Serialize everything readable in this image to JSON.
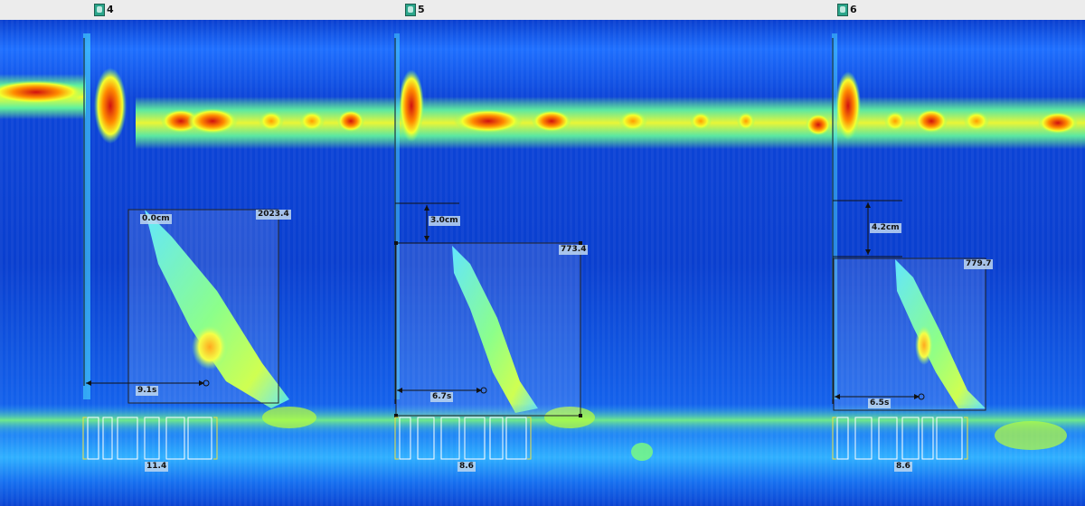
{
  "markers": [
    {
      "label": "4",
      "icon": "swallow-marker-icon"
    },
    {
      "label": "5",
      "icon": "swallow-marker-icon"
    },
    {
      "label": "6",
      "icon": "swallow-marker-icon"
    }
  ],
  "colors": {
    "background": "#0a3fcf",
    "colormap": [
      "#0000b4",
      "#0a3fcf",
      "#2aa8ff",
      "#4de3ff",
      "#7dff7a",
      "#f4ff2e",
      "#ff9d00",
      "#e61616"
    ]
  },
  "chart_data": {
    "type": "heatmap",
    "title": "",
    "swallows": [
      {
        "marker": "4",
        "dci": "2023.4",
        "distance": "0.0cm",
        "time": "9.1s",
        "irp": "11.4"
      },
      {
        "marker": "5",
        "dci": "773.4",
        "distance": "3.0cm",
        "time": "6.7s",
        "irp": "8.6"
      },
      {
        "marker": "6",
        "dci": "779.7",
        "distance": "4.2cm",
        "time": "6.5s",
        "irp": "8.6"
      }
    ]
  }
}
